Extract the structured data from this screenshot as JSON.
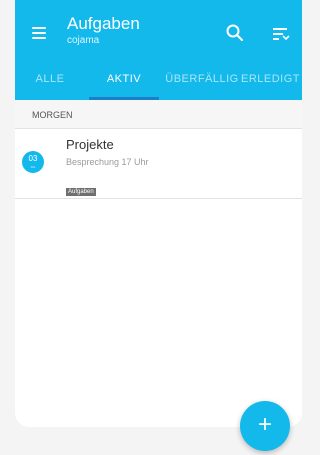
{
  "app": {
    "title": "Aufgaben",
    "subtitle": "cojama",
    "accent": "#14b9ec"
  },
  "tabs": [
    {
      "label": "ALLE",
      "active": false
    },
    {
      "label": "AKTIV",
      "active": true
    },
    {
      "label": "ÜBERFÄLLIG",
      "active": false
    },
    {
      "label": "ERLEDIGT",
      "active": false
    }
  ],
  "section": {
    "label": "MORGEN"
  },
  "tasks": [
    {
      "date_day": "03",
      "date_month": "JUL",
      "title": "Projekte",
      "description": "Besprechung 17 Uhr",
      "tag": "Aufgaben"
    }
  ],
  "icons": {
    "menu": "menu-icon",
    "search": "search-icon",
    "filter": "sort-filter-icon",
    "add": "add-icon"
  },
  "fab": {
    "label": "+"
  }
}
